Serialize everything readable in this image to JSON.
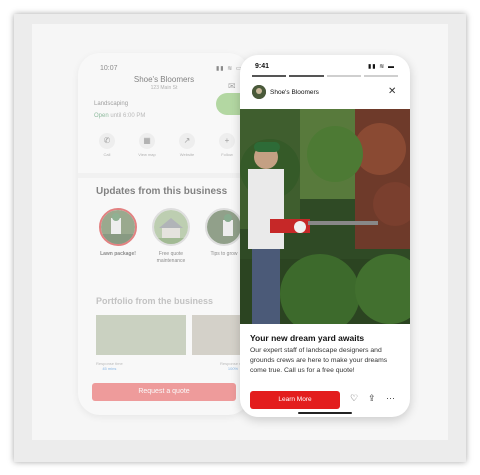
{
  "back_phone": {
    "time": "10:07",
    "status_icons": "▮▮ ≋ ▭",
    "business_name": "Shoe's Bloomers",
    "address": "123 Main St",
    "category": "Landscaping",
    "open_label": "Open",
    "hours": "until 6:00 PM",
    "actions": [
      {
        "label": "Call",
        "icon": "phone-icon",
        "glyph": "✆"
      },
      {
        "label": "View map",
        "icon": "map-icon",
        "glyph": "▦"
      },
      {
        "label": "Website",
        "icon": "external-link-icon",
        "glyph": "↗"
      },
      {
        "label": "Follow",
        "icon": "plus-icon",
        "glyph": "+"
      }
    ],
    "updates_title": "Updates from this business",
    "updates": [
      {
        "label": "Lawn package!"
      },
      {
        "label": "Free quote maintenance"
      },
      {
        "label": "Tips to grow"
      }
    ],
    "portfolio_title": "Portfolio from the business",
    "response_time_label": "Response time",
    "response_time_value": "45 mins",
    "response_rate_label": "Response rate",
    "response_rate_value": "100%",
    "quote_button": "Request a quote"
  },
  "front_phone": {
    "time": "9:41",
    "status_icons": "▮▮ ≋ ▬",
    "business_name": "Shoe's Bloomers",
    "close_glyph": "✕",
    "headline": "Your new dream yard awaits",
    "body": "Our expert staff of landscape designers and grounds crews are here to make your dreams come true. Call us for a free quote!",
    "cta": "Learn More",
    "icons": {
      "save": "♡",
      "share": "⇪",
      "more": "···"
    }
  },
  "colors": {
    "brand_red": "#e31d1d",
    "open_green": "#3a8a55"
  }
}
